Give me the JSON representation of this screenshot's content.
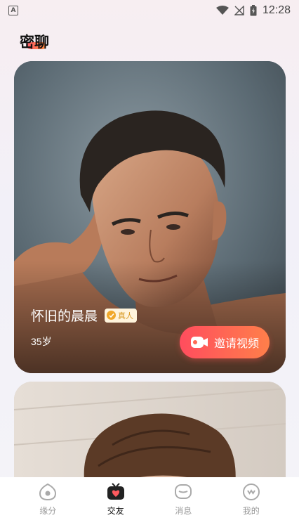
{
  "status_bar": {
    "time": "12:28",
    "notification_icon": "A"
  },
  "header": {
    "title": "密聊"
  },
  "cards": [
    {
      "name": "怀旧的晨晨",
      "verified_label": "真人",
      "age": "35岁",
      "invite_label": "邀请视频"
    }
  ],
  "tabs": [
    {
      "label": "缘分",
      "icon": "eye-heart-icon",
      "active": false
    },
    {
      "label": "交友",
      "icon": "tv-heart-icon",
      "active": true
    },
    {
      "label": "消息",
      "icon": "chat-bubble-icon",
      "active": false
    },
    {
      "label": "我的",
      "icon": "smile-face-icon",
      "active": false
    }
  ],
  "colors": {
    "accent_start": "#ff4d5e",
    "accent_end": "#ff7f4a",
    "badge": "#f0a82a"
  }
}
